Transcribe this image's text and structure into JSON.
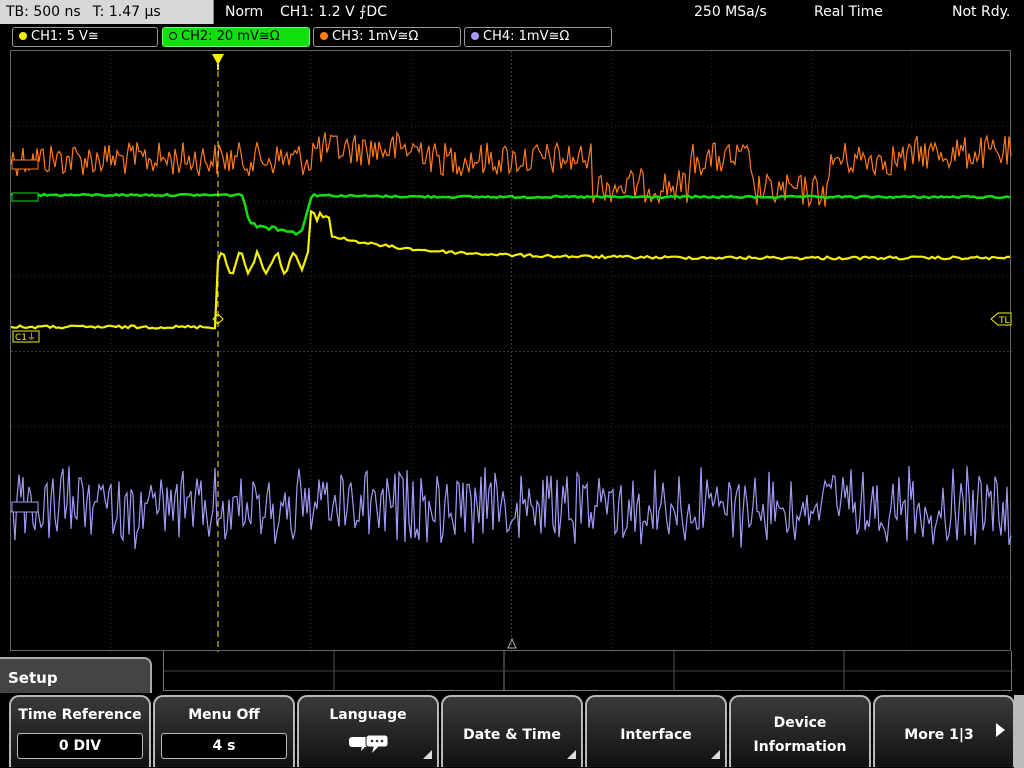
{
  "topbar": {
    "timebase": "TB: 500 ns",
    "trigger_time": "T: 1.47 µs",
    "mode": "Norm",
    "trigger_source": "CH1: 1.2 V ⨍DC",
    "sample_rate": "250 MSa/s",
    "acq_mode": "Real Time",
    "state": "Not Rdy."
  },
  "channels": [
    {
      "label": "CH1: 5 V≅",
      "color": "#f5f000"
    },
    {
      "label": "CH2: 20 mV≅Ω",
      "color": "#10e010"
    },
    {
      "label": "CH3: 1mV≅Ω",
      "color": "#ff7a1a"
    },
    {
      "label": "CH4: 1mV≅Ω",
      "color": "#9f9af5"
    }
  ],
  "markers": {
    "trigger_level": "TL",
    "ch1_ground": "C1⏚"
  },
  "menu": {
    "title": "Setup",
    "time_reference": {
      "label": "Time Reference",
      "value": "0 DIV"
    },
    "menu_off": {
      "label": "Menu Off",
      "value": "4 s"
    },
    "language": {
      "label": "Language",
      "icon": "speech-bubbles-icon"
    },
    "date_time": {
      "label": "Date & Time"
    },
    "interface": {
      "label": "Interface"
    },
    "device_info": {
      "line1": "Device",
      "line2": "Information"
    },
    "more": {
      "label": "More 1|3"
    }
  }
}
